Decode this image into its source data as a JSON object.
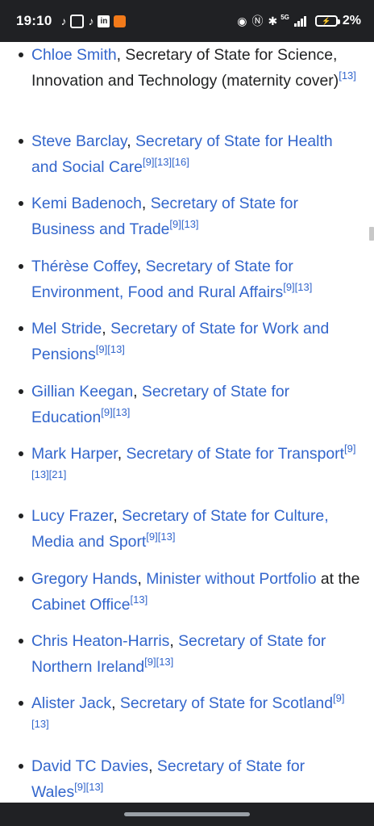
{
  "status_bar": {
    "time": "19:10",
    "battery_percent": "2%",
    "network": "5G",
    "icons": [
      "tiktok-icon",
      "instagram-icon",
      "tiktok-icon",
      "linkedin-icon",
      "notification-icon",
      "eye-icon",
      "nfc-icon",
      "bluetooth-icon",
      "signal-icon",
      "battery-charging-icon"
    ]
  },
  "items": [
    {
      "name": "Chloe Smith",
      "sep": ", ",
      "role": "Secretary of State for Science, Innovation and Technology (maternity cover)",
      "role_linked": false,
      "refs": "[13]"
    },
    {
      "name": "Steve Barclay",
      "sep": ", ",
      "role": "Secretary of State for Health and Social Care",
      "role_linked": true,
      "refs": "[9][13][16]"
    },
    {
      "name": "Kemi Badenoch",
      "sep": ", ",
      "role": "Secretary of State for Business and Trade",
      "role_linked": true,
      "refs": "[9][13]"
    },
    {
      "name": "Thérèse Coffey",
      "sep": ", ",
      "role": "Secretary of State for Environment, Food and Rural Affairs",
      "role_linked": true,
      "refs": "[9][13]"
    },
    {
      "name": "Mel Stride",
      "sep": ", ",
      "role": "Secretary of State for Work and Pensions",
      "role_linked": true,
      "refs": "[9][13]"
    },
    {
      "name": "Gillian Keegan",
      "sep": ", ",
      "role": "Secretary of State for Education",
      "role_linked": true,
      "refs": "[9][13]"
    },
    {
      "name": "Mark Harper",
      "sep": ", ",
      "role": "Secretary of State for Transport",
      "role_linked": true,
      "refs": "[9][13][21]"
    },
    {
      "name": "Lucy Frazer",
      "sep": ", ",
      "role": "Secretary of State for Culture, Media and Sport",
      "role_linked": true,
      "refs": "[9][13]"
    },
    {
      "name": "Gregory Hands",
      "sep": ", ",
      "role": "Minister without Portfolio",
      "role_linked": true,
      "extra_text": " at the ",
      "extra_link": "Cabinet Office",
      "refs": "[13]"
    },
    {
      "name": "Chris Heaton-Harris",
      "sep": ", ",
      "role": "Secretary of State for Northern Ireland",
      "role_linked": true,
      "refs": "[9][13]"
    },
    {
      "name": "Alister Jack",
      "sep": ", ",
      "role": "Secretary of State for Scotland",
      "role_linked": true,
      "refs": "[9][13]"
    },
    {
      "name": "David TC Davies",
      "sep": ", ",
      "role": "Secretary of State for Wales",
      "role_linked": true,
      "refs": "[9][13]"
    }
  ],
  "colors": {
    "link": "#3366cc",
    "text": "#202122",
    "status_bar": "#202124"
  }
}
